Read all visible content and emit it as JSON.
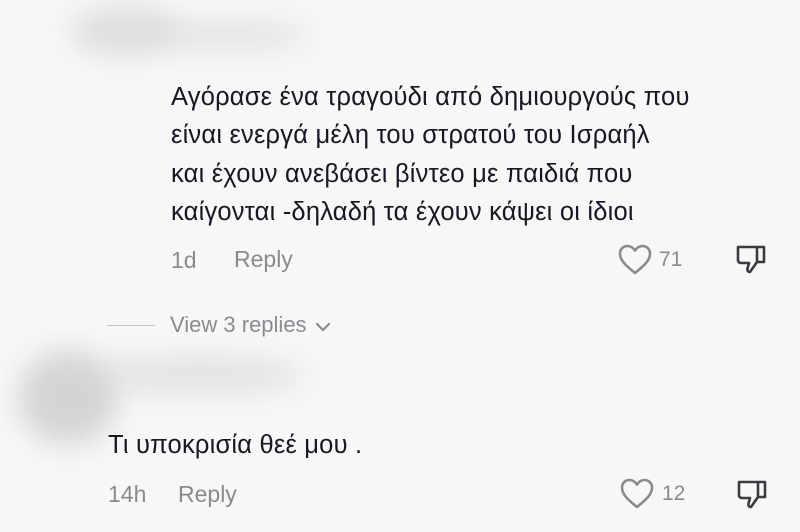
{
  "comments": [
    {
      "text_lines": [
        "Αγόρασε ένα τραγούδι από δημιουργούς που",
        "είναι ενεργά μέλη του στρατού του Ισραήλ",
        "και έχουν ανεβάσει βίντεο με παιδιά που",
        "καίγονται -δηλαδή τα έχουν κάψει οι ίδιοι"
      ],
      "time": "1d",
      "reply_label": "Reply",
      "likes": "71",
      "view_replies_label": "View 3 replies"
    },
    {
      "text_lines": [
        "Τι υποκρισία θεέ μου ."
      ],
      "time": "14h",
      "reply_label": "Reply",
      "likes": "12"
    }
  ],
  "icons": {
    "like": "heart-outline-icon",
    "dislike": "thumbs-down-outline-icon",
    "expand": "chevron-down-icon"
  },
  "colors": {
    "background": "#f7f7f7",
    "text": "#161823",
    "secondary": "#8a8b91"
  }
}
